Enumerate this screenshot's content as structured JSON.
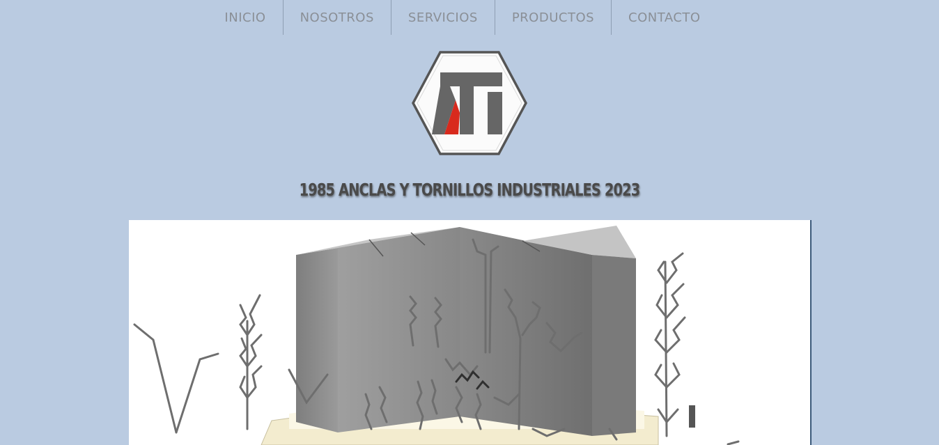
{
  "nav": {
    "items": [
      {
        "label": "INICIO"
      },
      {
        "label": "NOSOTROS"
      },
      {
        "label": "SERVICIOS"
      },
      {
        "label": "PRODUCTOS"
      },
      {
        "label": "CONTACTO"
      }
    ]
  },
  "logo": {
    "text": "ATI",
    "colors": {
      "frame": "#5b5b5b",
      "letters": "#666666",
      "accent": "#d82a1d"
    }
  },
  "headline": "1985 ANCLAS Y TORNILLOS INDUSTRIALES 2023",
  "colors": {
    "page_background": "#bacbe1",
    "nav_text": "#8a8f96",
    "headline_text": "#4a4a4a"
  }
}
